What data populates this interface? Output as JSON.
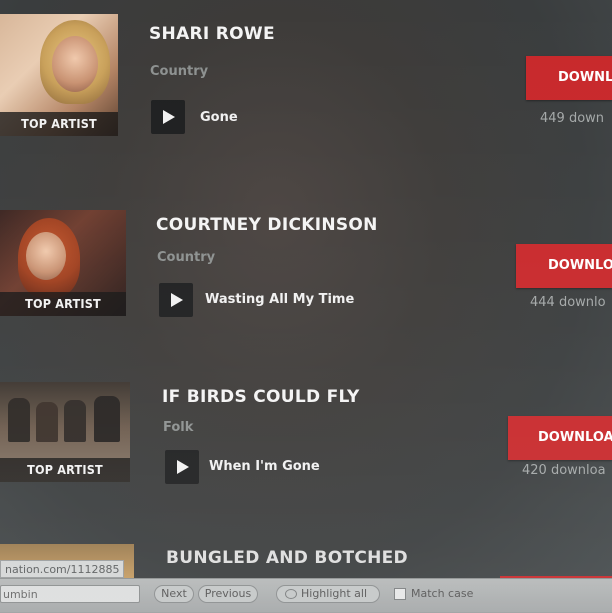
{
  "cards": [
    {
      "badge": "TOP ARTIST",
      "name": "SHARI ROWE",
      "genre": "Country",
      "song": "Gone",
      "download_label": "DOWNL",
      "download_count": "449 down"
    },
    {
      "badge": "TOP ARTIST",
      "name": "COURTNEY DICKINSON",
      "genre": "Country",
      "song": "Wasting All My Time",
      "download_label": "DOWNLO",
      "download_count": "444 downlo"
    },
    {
      "badge": "TOP ARTIST",
      "name": "IF BIRDS COULD FLY",
      "genre": "Folk",
      "song": "When I'm Gone",
      "download_label": "DOWNLOAD",
      "download_count": "420 downloa"
    },
    {
      "name": "BUNGLED AND BOTCHED"
    }
  ],
  "status_url": "nation.com/1112885",
  "find_bar": {
    "query": "umbin",
    "next_label": "Next",
    "previous_label": "Previous",
    "highlight_label": "Highlight all",
    "match_case_label": "Match case"
  },
  "colors": {
    "download_red": "#c8282b",
    "badge_bg": "#141414",
    "play_bg": "#1e1f20"
  }
}
